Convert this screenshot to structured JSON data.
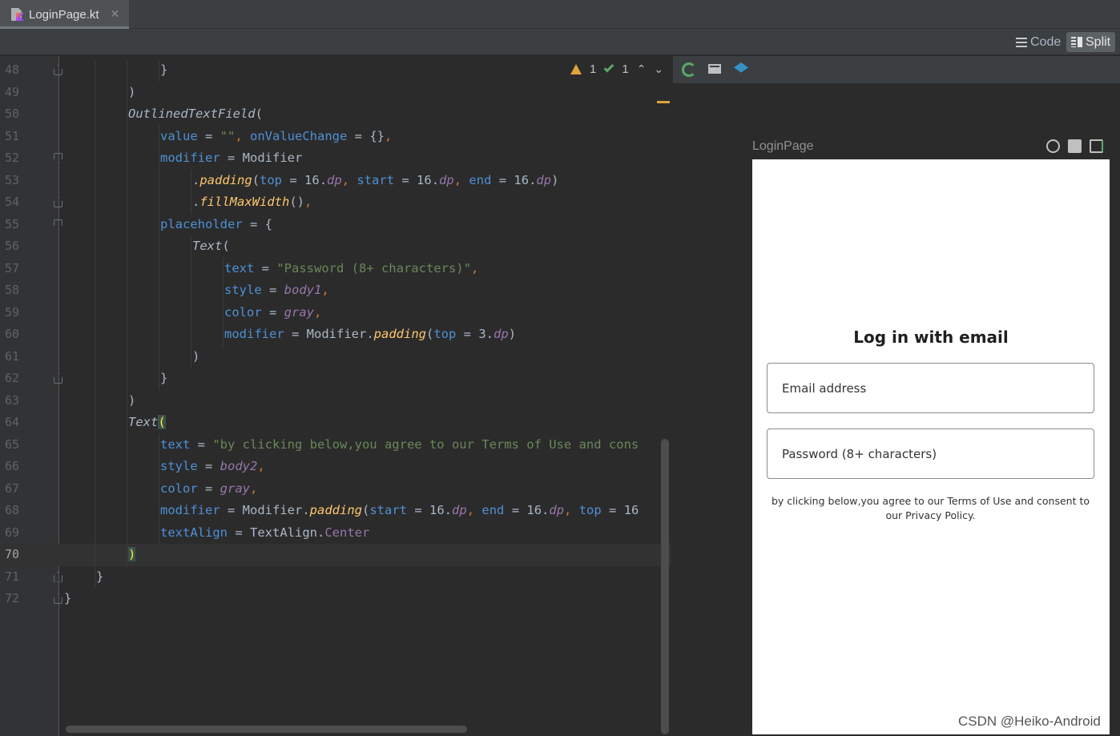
{
  "tab": {
    "label": "LoginPage.kt",
    "close": "✕"
  },
  "modes": {
    "code": "Code",
    "split": "Split"
  },
  "inspections": {
    "warnings": "1",
    "weak_warnings": "1",
    "up": "⌃",
    "down": "⌄"
  },
  "code_lines": [
    {
      "n": "48",
      "indent": 3,
      "fold": "up",
      "tokens": [
        [
          "}",
          "k-plain"
        ]
      ]
    },
    {
      "n": "49",
      "indent": 2,
      "tokens": [
        [
          ")",
          "k-plain"
        ]
      ]
    },
    {
      "n": "50",
      "indent": 2,
      "tokens": [
        [
          "OutlinedTextField",
          "k-fn"
        ],
        [
          "(",
          "k-plain"
        ]
      ]
    },
    {
      "n": "51",
      "indent": 3,
      "tokens": [
        [
          "value",
          "k-param"
        ],
        [
          " = ",
          "k-plain"
        ],
        [
          "\"\"",
          "k-str"
        ],
        [
          ", ",
          "k-orange"
        ],
        [
          "onValueChange",
          "k-param"
        ],
        [
          " = ",
          "k-plain"
        ],
        [
          "{}",
          "k-plain"
        ],
        [
          ",",
          "k-orange"
        ]
      ]
    },
    {
      "n": "52",
      "indent": 3,
      "fold": "down",
      "tokens": [
        [
          "modifier",
          "k-param"
        ],
        [
          " = ",
          "k-plain"
        ],
        [
          "Modifier",
          "k-plain"
        ]
      ]
    },
    {
      "n": "53",
      "indent": 4,
      "tokens": [
        [
          ".",
          "k-plain"
        ],
        [
          "padding",
          "k-fn-y"
        ],
        [
          "(",
          "k-plain"
        ],
        [
          "top",
          "k-param"
        ],
        [
          " = ",
          "k-plain"
        ],
        [
          "16",
          "k-plain"
        ],
        [
          ".",
          "k-plain"
        ],
        [
          "dp",
          "k-unit"
        ],
        [
          ", ",
          "k-orange"
        ],
        [
          "start",
          "k-param"
        ],
        [
          " = ",
          "k-plain"
        ],
        [
          "16",
          "k-plain"
        ],
        [
          ".",
          "k-plain"
        ],
        [
          "dp",
          "k-unit"
        ],
        [
          ", ",
          "k-orange"
        ],
        [
          "end",
          "k-param"
        ],
        [
          " = ",
          "k-plain"
        ],
        [
          "16",
          "k-plain"
        ],
        [
          ".",
          "k-plain"
        ],
        [
          "dp",
          "k-unit"
        ],
        [
          ")",
          "k-plain"
        ]
      ]
    },
    {
      "n": "54",
      "indent": 4,
      "fold": "up",
      "tokens": [
        [
          ".",
          "k-plain"
        ],
        [
          "fillMaxWidth",
          "k-fn-y"
        ],
        [
          "()",
          "k-plain"
        ],
        [
          ",",
          "k-orange"
        ]
      ]
    },
    {
      "n": "55",
      "indent": 3,
      "fold": "down",
      "tokens": [
        [
          "placeholder",
          "k-param"
        ],
        [
          " = ",
          "k-plain"
        ],
        [
          "{",
          "k-plain"
        ]
      ]
    },
    {
      "n": "56",
      "indent": 4,
      "tokens": [
        [
          "Text",
          "k-fn"
        ],
        [
          "(",
          "k-plain"
        ]
      ]
    },
    {
      "n": "57",
      "indent": 5,
      "tokens": [
        [
          "text",
          "k-param"
        ],
        [
          " = ",
          "k-plain"
        ],
        [
          "\"Password (8+ characters)\"",
          "k-str"
        ],
        [
          ",",
          "k-orange"
        ]
      ]
    },
    {
      "n": "58",
      "indent": 5,
      "tokens": [
        [
          "style",
          "k-param"
        ],
        [
          " = ",
          "k-plain"
        ],
        [
          "body1",
          "k-purple"
        ],
        [
          ",",
          "k-orange"
        ]
      ]
    },
    {
      "n": "59",
      "indent": 5,
      "tokens": [
        [
          "color",
          "k-param"
        ],
        [
          " = ",
          "k-plain"
        ],
        [
          "gray",
          "k-purple"
        ],
        [
          ",",
          "k-orange"
        ]
      ]
    },
    {
      "n": "60",
      "indent": 5,
      "tokens": [
        [
          "modifier",
          "k-param"
        ],
        [
          " = ",
          "k-plain"
        ],
        [
          "Modifier",
          "k-plain"
        ],
        [
          ".",
          "k-plain"
        ],
        [
          "padding",
          "k-fn-y"
        ],
        [
          "(",
          "k-plain"
        ],
        [
          "top",
          "k-param"
        ],
        [
          " = ",
          "k-plain"
        ],
        [
          "3",
          "k-plain"
        ],
        [
          ".",
          "k-plain"
        ],
        [
          "dp",
          "k-unit"
        ],
        [
          ")",
          "k-plain"
        ]
      ]
    },
    {
      "n": "61",
      "indent": 4,
      "tokens": [
        [
          ")",
          "k-plain"
        ]
      ]
    },
    {
      "n": "62",
      "indent": 3,
      "fold": "up",
      "tokens": [
        [
          "}",
          "k-plain"
        ]
      ]
    },
    {
      "n": "63",
      "indent": 2,
      "tokens": [
        [
          ")",
          "k-plain"
        ]
      ]
    },
    {
      "n": "64",
      "indent": 2,
      "tokens": [
        [
          "Text",
          "k-fn"
        ],
        [
          "(",
          "brace-hl"
        ]
      ]
    },
    {
      "n": "65",
      "indent": 3,
      "tokens": [
        [
          "text",
          "k-param"
        ],
        [
          " = ",
          "k-plain"
        ],
        [
          "\"by clicking below,you agree to our Terms of Use and cons",
          "k-str"
        ]
      ]
    },
    {
      "n": "66",
      "indent": 3,
      "tokens": [
        [
          "style",
          "k-param"
        ],
        [
          " = ",
          "k-plain"
        ],
        [
          "body2",
          "k-purple"
        ],
        [
          ",",
          "k-orange"
        ]
      ]
    },
    {
      "n": "67",
      "indent": 3,
      "tokens": [
        [
          "color",
          "k-param"
        ],
        [
          " = ",
          "k-plain"
        ],
        [
          "gray",
          "k-purple"
        ],
        [
          ",",
          "k-orange"
        ]
      ]
    },
    {
      "n": "68",
      "indent": 3,
      "tokens": [
        [
          "modifier",
          "k-param"
        ],
        [
          " = ",
          "k-plain"
        ],
        [
          "Modifier",
          "k-plain"
        ],
        [
          ".",
          "k-plain"
        ],
        [
          "padding",
          "k-fn-y"
        ],
        [
          "(",
          "k-plain"
        ],
        [
          "start",
          "k-param"
        ],
        [
          " = ",
          "k-plain"
        ],
        [
          "16",
          "k-plain"
        ],
        [
          ".",
          "k-plain"
        ],
        [
          "dp",
          "k-unit"
        ],
        [
          ", ",
          "k-orange"
        ],
        [
          "end",
          "k-param"
        ],
        [
          " = ",
          "k-plain"
        ],
        [
          "16",
          "k-plain"
        ],
        [
          ".",
          "k-plain"
        ],
        [
          "dp",
          "k-unit"
        ],
        [
          ", ",
          "k-orange"
        ],
        [
          "top",
          "k-param"
        ],
        [
          " = ",
          "k-plain"
        ],
        [
          "16",
          "k-plain"
        ]
      ]
    },
    {
      "n": "69",
      "indent": 3,
      "tokens": [
        [
          "textAlign",
          "k-param"
        ],
        [
          " = ",
          "k-plain"
        ],
        [
          "TextAlign",
          "k-plain"
        ],
        [
          ".",
          "k-plain"
        ],
        [
          "Center",
          "k-prop"
        ]
      ]
    },
    {
      "n": "70",
      "indent": 2,
      "current": true,
      "tokens": [
        [
          ")",
          "brace-hl"
        ]
      ]
    },
    {
      "n": "71",
      "indent": 1,
      "fold": "up",
      "tokens": [
        [
          "}",
          "k-plain"
        ]
      ]
    },
    {
      "n": "72",
      "indent": 0,
      "fold": "up",
      "tokens": [
        [
          "}",
          "k-plain"
        ]
      ]
    }
  ],
  "preview": {
    "title": "LoginPage",
    "screen_title": "Log in with email",
    "email_placeholder": "Email address",
    "password_placeholder": "Password (8+ characters)",
    "terms": "by clicking below,you agree to our Terms of Use and consent to our Privacy Policy."
  },
  "watermark": "CSDN @Heiko-Android",
  "colors": {
    "editor_bg": "#2b2b2b",
    "gutter_bg": "#313335",
    "keyword": "#cc7832",
    "string": "#6a8759",
    "param": "#4e90d6",
    "function": "#ffc66d",
    "accent_green": "#59a869",
    "warning": "#e0a33a"
  }
}
